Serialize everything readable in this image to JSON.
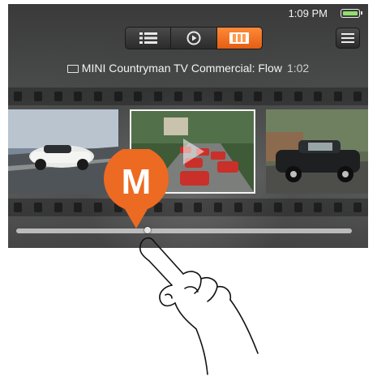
{
  "status_bar": {
    "time": "1:09 PM"
  },
  "toolbar": {
    "view_modes": [
      {
        "icon": "list-icon",
        "active": false
      },
      {
        "icon": "play-icon",
        "active": false
      },
      {
        "icon": "filmstrip-icon",
        "active": true
      }
    ],
    "menu_icon": "hamburger-menu-icon"
  },
  "video": {
    "icon": "film-icon",
    "title": "MINI Countryman TV Commercial: Flow",
    "duration": "1:02"
  },
  "marker": {
    "letter": "M",
    "color": "#ec6a22"
  },
  "scrubber": {
    "position_fraction": 0.38
  },
  "colors": {
    "accent": "#ec6a22",
    "battery": "#8fe06a"
  }
}
